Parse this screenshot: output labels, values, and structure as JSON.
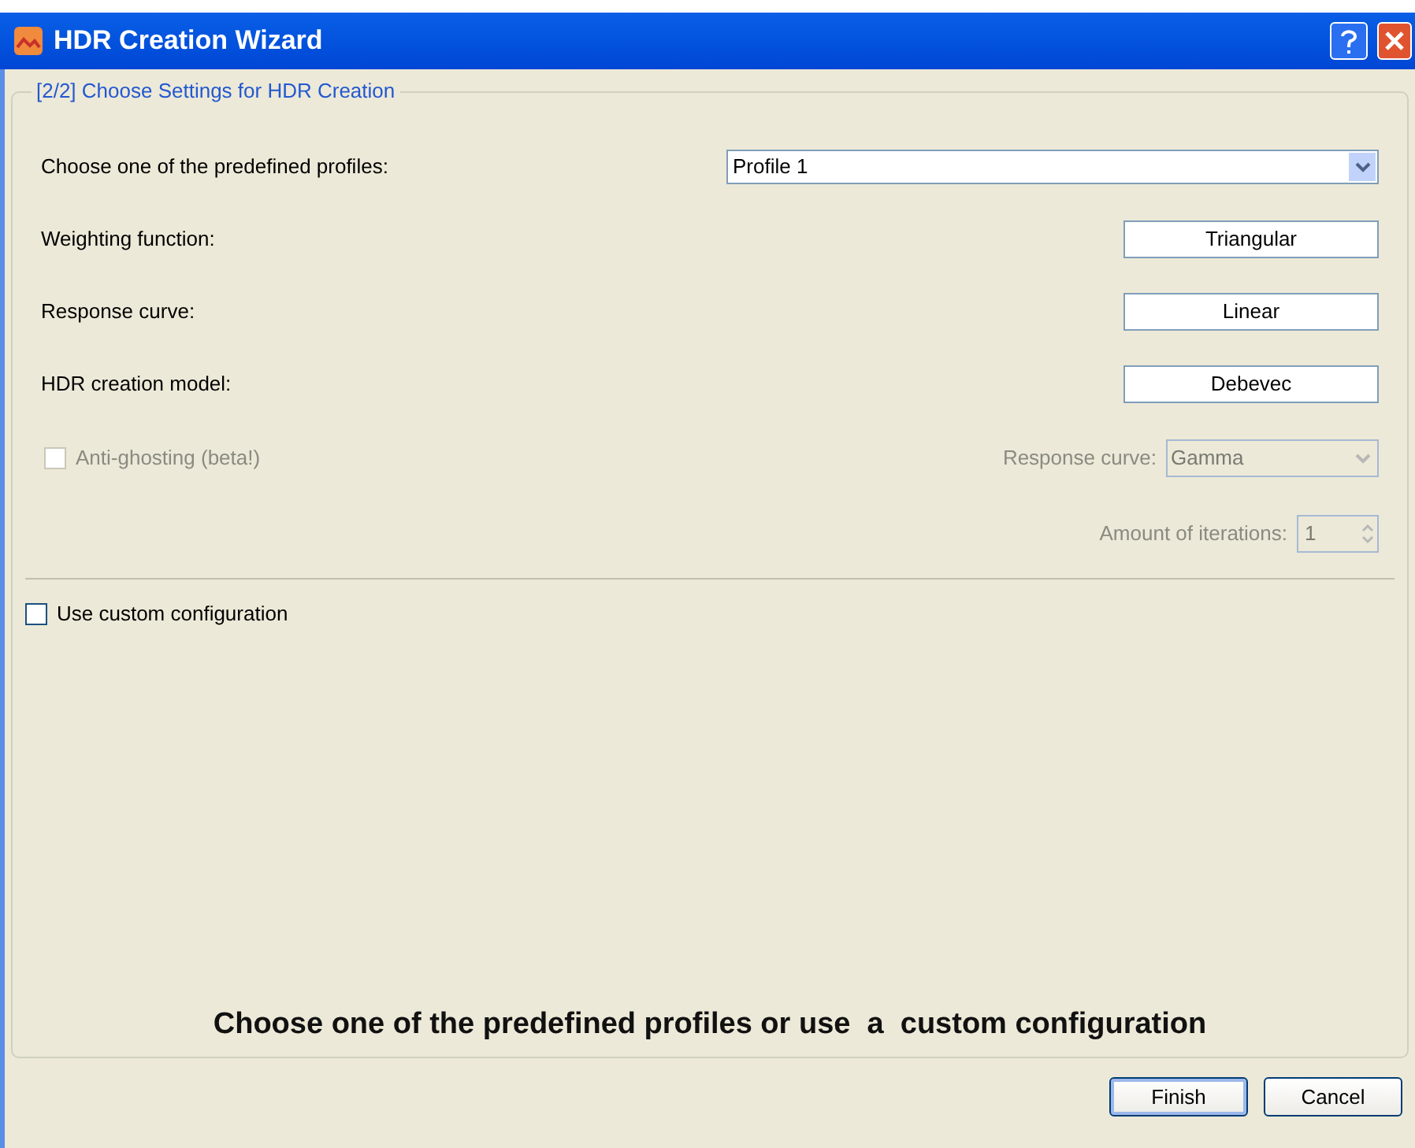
{
  "window": {
    "title": "HDR Creation Wizard"
  },
  "group": {
    "title": "[2/2] Choose Settings for HDR Creation"
  },
  "settings": [
    {
      "kind": "select",
      "label": "Choose one of the predefined profiles:",
      "value": "Profile 1"
    },
    {
      "kind": "button",
      "label": "Weighting function:",
      "value": "Triangular"
    },
    {
      "kind": "button",
      "label": "Response curve:",
      "value": "Linear"
    },
    {
      "kind": "button",
      "label": "HDR creation model:",
      "value": "Debevec"
    }
  ],
  "anti_ghosting": {
    "label": "Anti-ghosting (beta!)",
    "checked": false,
    "disabled": true,
    "response_curve": {
      "label": "Response curve:",
      "value": "Gamma",
      "disabled": true
    },
    "iterations": {
      "label": "Amount of iterations:",
      "value": "1",
      "disabled": true
    }
  },
  "custom_configuration": {
    "label": "Use custom configuration",
    "checked": false
  },
  "hint": "Choose one of the predefined profiles or use  a  custom configuration",
  "buttons": [
    {
      "label": "Finish",
      "default": true
    },
    {
      "label": "Cancel",
      "default": false
    }
  ]
}
